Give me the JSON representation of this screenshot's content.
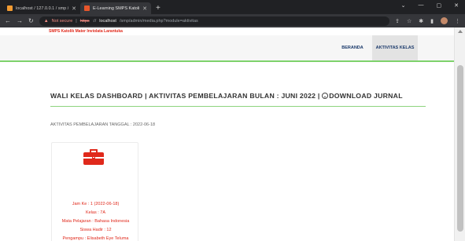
{
  "browser": {
    "tabs": [
      {
        "title": "localhost / 127.0.0.1 / smp / kec",
        "active": false
      },
      {
        "title": "E-Learning SMPS Katolik Mater I",
        "active": true
      }
    ],
    "new_tab_glyph": "+",
    "url": {
      "warning": "Not secure",
      "protocol": "https",
      "host": "localhost",
      "path": "/smp/admin/media.php?module=aktivitas"
    }
  },
  "site": {
    "brand": "SMPS Katolik Mater Inviolata Larantuka",
    "nav": [
      {
        "label": "BERANDA",
        "active": false
      },
      {
        "label": "AKTIVITAS KELAS",
        "active": true
      }
    ]
  },
  "main": {
    "heading": "WALI KELAS DASHBOARD | AKTIVITAS PEMBELAJARAN BULAN : JUNI 2022 |",
    "download_label": "DOWNLOAD JURNAL",
    "date_label": "AKTIVITAS PEMBELAJARAN TANGGAL : 2022-06-18",
    "card": {
      "icon": "briefcase-icon",
      "lines": [
        "Jam Ke : 1 (2022-06-18)",
        "Kelas : 7A",
        "Mata Pelajaran : Bahasa Indonesia",
        "Siswa Hadir : 12",
        "Pengampu : Elisabeth Eye Teluma"
      ]
    }
  },
  "colors": {
    "accent_red": "#e0291b",
    "accent_green": "#7ed26b",
    "nav_text": "#1b3a6b"
  }
}
